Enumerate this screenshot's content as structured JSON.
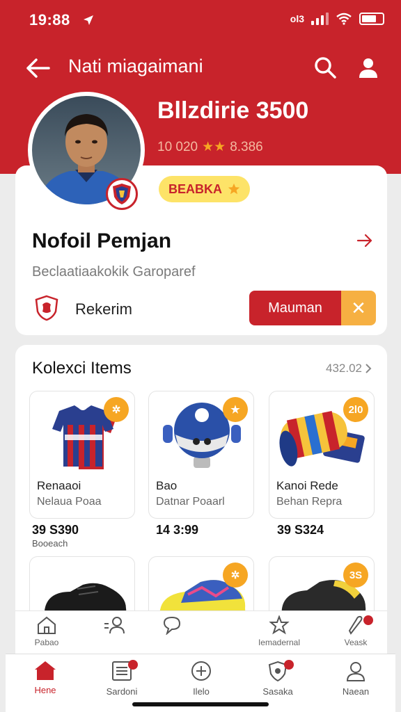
{
  "status": {
    "time": "19:88",
    "carrier": "ol3"
  },
  "nav": {
    "title": "Nati miagaimani"
  },
  "header": {
    "price": "Bllzdirie 3500",
    "rating_value": "10 020",
    "rating_stars": "★★",
    "rating_count": "8.386"
  },
  "profile": {
    "rank_label": "BEABKA",
    "name": "Nofoil Pemjan",
    "subtitle": "Beclaatiaakokik Garoparef",
    "club_name": "Rekerim",
    "action_label": "Mauman",
    "close_glyph": "✕"
  },
  "collection": {
    "title": "Kolexci Items",
    "more_label": "432.02",
    "items": [
      {
        "name": "Renaaoi",
        "sub": "Nelaua Poaa",
        "price": "39 S390",
        "sold": "Booeach",
        "badge": "✲"
      },
      {
        "name": "Bao",
        "sub": "Datnar Poaarl",
        "price": "14 3:99",
        "sold": "",
        "badge": "★"
      },
      {
        "name": "Kanoi Rede",
        "sub": "Behan Repra",
        "price": "39 S324",
        "sold": "",
        "badge": "2l0"
      },
      {
        "name": "",
        "sub": "",
        "price": "",
        "sold": "",
        "badge": ""
      },
      {
        "name": "",
        "sub": "",
        "price": "",
        "sold": "",
        "badge": "✲"
      },
      {
        "name": "",
        "sub": "",
        "price": "",
        "sold": "",
        "badge": "3S"
      }
    ]
  },
  "sub_nav": [
    {
      "label": "Pabao",
      "icon": "home-outline-icon"
    },
    {
      "label": "",
      "icon": "people-icon"
    },
    {
      "label": "",
      "icon": "chat-icon"
    },
    {
      "label": "Iemadernal",
      "icon": "star-badge-icon"
    },
    {
      "label": "Veask",
      "icon": "trophy-icon"
    }
  ],
  "tabs": [
    {
      "label": "Hene",
      "icon": "home-icon"
    },
    {
      "label": "Sardoni",
      "icon": "list-icon"
    },
    {
      "label": "Ilelo",
      "icon": "plus-icon"
    },
    {
      "label": "Sasaka",
      "icon": "shield-icon"
    },
    {
      "label": "Naean",
      "icon": "person-icon"
    }
  ],
  "colors": {
    "brand_red": "#c8232b",
    "accent_yellow": "#f6a623",
    "badge_yellow": "#fde368"
  }
}
